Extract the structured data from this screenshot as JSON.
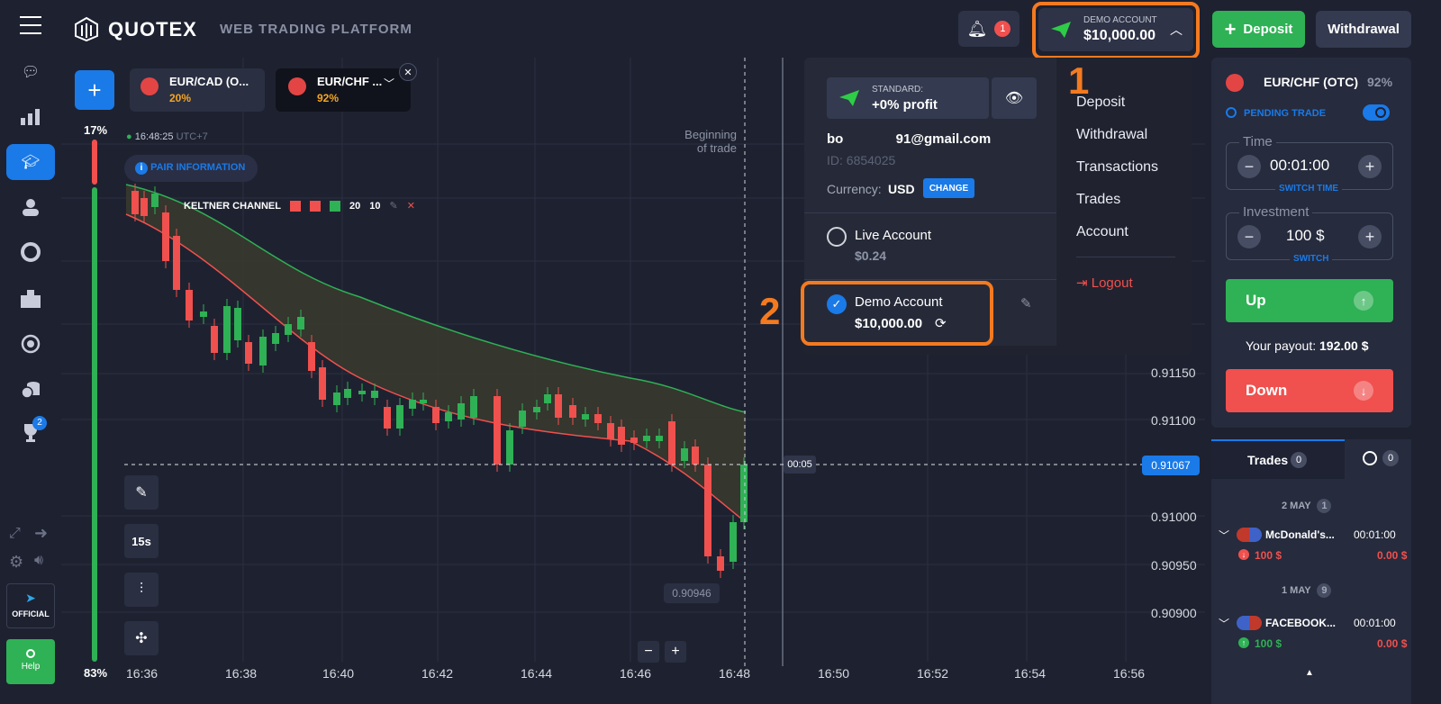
{
  "header": {
    "brand": "QUOTEX",
    "subtitle": "WEB TRADING PLATFORM",
    "notif_count": "1",
    "account_label": "DEMO ACCOUNT",
    "account_balance": "$10,000.00",
    "deposit": "Deposit",
    "withdrawal": "Withdrawal"
  },
  "sidebar": {
    "official": "OFFICIAL",
    "help": "Help",
    "badge": "2"
  },
  "tabs": [
    {
      "name": "EUR/CAD (O...",
      "pct": "20%"
    },
    {
      "name": "EUR/CHF ...",
      "pct": "92%"
    }
  ],
  "chart": {
    "time": "16:48:25",
    "tz": "UTC+7",
    "pair_info": "PAIR INFORMATION",
    "indicator": "KELTNER CHANNEL",
    "ind_a": "20",
    "ind_b": "10",
    "pct_top": "17%",
    "pct_bottom": "83%",
    "beginning": "Beginning of trade",
    "timer": "00:05",
    "price_label": "0.91067",
    "low_label": "0.90946",
    "period": "15s",
    "yticks": [
      "0.91150",
      "0.91100",
      "0.91000",
      "0.90950",
      "0.90900"
    ],
    "xticks": [
      "16:36",
      "16:38",
      "16:40",
      "16:42",
      "16:44",
      "16:46",
      "16:48",
      "16:50",
      "16:52",
      "16:54",
      "16:56"
    ]
  },
  "dropdown": {
    "type_label": "STANDARD:",
    "type_value": "+0% profit",
    "email": "bo              91@gmail.com",
    "id": "ID: 6854025",
    "currency_label": "Currency:",
    "currency": "USD",
    "change": "CHANGE",
    "live_label": "Live Account",
    "live_balance": "$0.24",
    "demo_label": "Demo Account",
    "demo_balance": "$10,000.00",
    "menu": [
      "Deposit",
      "Withdrawal",
      "Transactions",
      "Trades",
      "Account"
    ],
    "logout": "Logout",
    "n1": "1",
    "n2": "2"
  },
  "panel": {
    "pair": "EUR/CHF (OTC)",
    "pct": "92%",
    "pending": "PENDING TRADE",
    "time_label": "Time",
    "time": "00:01:00",
    "switch_time": "SWITCH TIME",
    "invest_label": "Investment",
    "invest": "100 $",
    "switch": "SWITCH",
    "up": "Up",
    "payout_label": "Your payout:",
    "payout": "192.00 $",
    "down": "Down"
  },
  "trades": {
    "tab": "Trades",
    "count": "0",
    "hist_count": "0",
    "groups": [
      {
        "date": "2 MAY",
        "count": "1",
        "name": "McDonald's...",
        "dur": "00:01:00",
        "amount": "100 $",
        "result": "0.00 $"
      },
      {
        "date": "1 MAY",
        "count": "9",
        "name": "FACEBOOK...",
        "dur": "00:01:00",
        "amount": "100 $",
        "result": "0.00 $"
      }
    ]
  }
}
